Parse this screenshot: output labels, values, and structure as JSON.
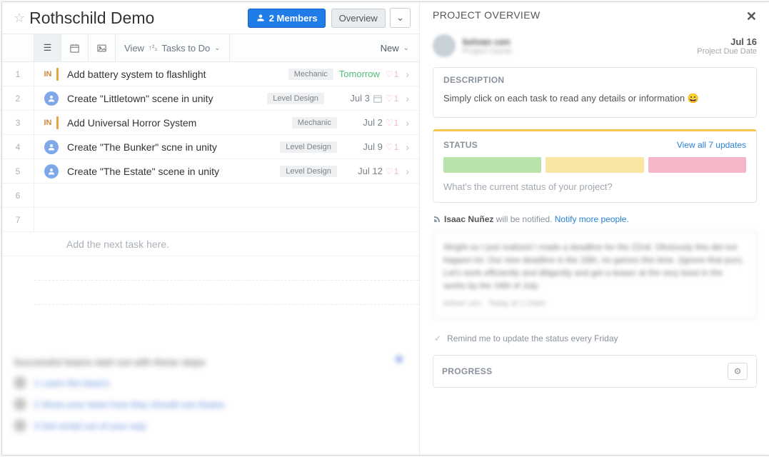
{
  "project": {
    "title": "Rothschild Demo",
    "members_label": "2 Members",
    "overview_btn": "Overview"
  },
  "toolbar": {
    "view_label": "View",
    "view_mode": "Tasks to Do",
    "new_label": "New"
  },
  "tasks": [
    {
      "num": "1",
      "assignee_type": "initials",
      "assignee": "IN",
      "title": "Add battery system to flashlight",
      "tag": "Mechanic",
      "due": "Tomorrow",
      "due_style": "tomorrow",
      "hearts": "1",
      "has_cal": false
    },
    {
      "num": "2",
      "assignee_type": "avatar",
      "assignee": "",
      "title": "Create \"Littletown\" scene in unity",
      "tag": "Level Design",
      "due": "Jul 3",
      "due_style": "",
      "hearts": "1",
      "has_cal": true
    },
    {
      "num": "3",
      "assignee_type": "initials",
      "assignee": "IN",
      "title": "Add Universal Horror System",
      "tag": "Mechanic",
      "due": "Jul 2",
      "due_style": "",
      "hearts": "1",
      "has_cal": false
    },
    {
      "num": "4",
      "assignee_type": "avatar",
      "assignee": "",
      "title": "Create \"The Bunker\" scne in unity",
      "tag": "Level Design",
      "due": "Jul 9",
      "due_style": "",
      "hearts": "1",
      "has_cal": false
    },
    {
      "num": "5",
      "assignee_type": "avatar",
      "assignee": "",
      "title": "Create \"The Estate\" scene in unity",
      "tag": "Level Design",
      "due": "Jul 12",
      "due_style": "",
      "hearts": "1",
      "has_cal": false
    }
  ],
  "empty_rows": [
    "6",
    "7"
  ],
  "add_task_placeholder": "Add the next task here.",
  "tips": {
    "title": "Successful teams start out with these steps",
    "items": [
      "1   Learn the basics",
      "2   Show your team how they should use Asana",
      "3   Get email out of your way"
    ]
  },
  "overview": {
    "title": "PROJECT OVERVIEW",
    "owner_name": "kelvan cen",
    "owner_role": "Project Owner",
    "due_date": "Jul 16",
    "due_label": "Project Due Date",
    "description_label": "DESCRIPTION",
    "description_body": "Simply click on each task to read any details or information 😀",
    "status_label": "STATUS",
    "status_link": "View all 7 updates",
    "status_placeholder": "What's the current status of your project?",
    "notify_name": "Isaac Nuñez",
    "notify_tail": " will be notified. ",
    "notify_link": "Notify more people.",
    "update_body": "Alright so I just realized I made a deadline for the 22nd. Obviously this did not happen lol. Our new deadline is the 16th, no games this time. (Ignore that pun). Let's work efficiently and diligently and get a teaser at the very least in the works by the 16th of July.",
    "update_meta": "kelvan cen · Today at 1:23am",
    "remind_label": "Remind me to update the status every Friday",
    "progress_label": "PROGRESS"
  }
}
